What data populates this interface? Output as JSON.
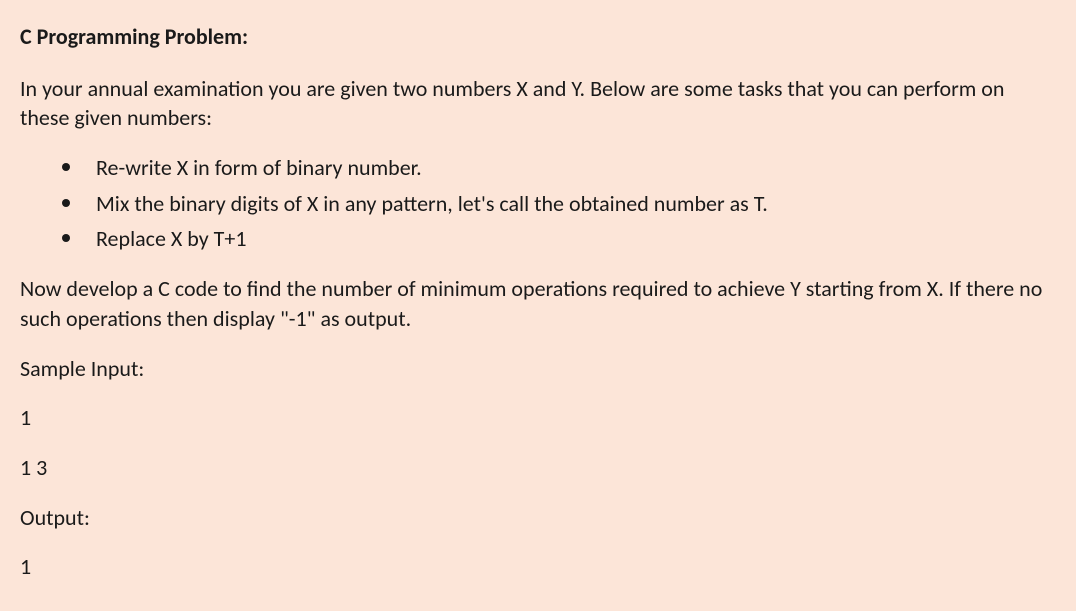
{
  "heading": "C Programming Problem:",
  "intro": "In your annual examination you are given two numbers X and Y. Below are some tasks that you can perform on these given numbers:",
  "bullets": [
    "Re-write X in form of binary number.",
    "Mix the binary digits of X in any pattern, let's call the obtained number as T.",
    "Replace X by T+1"
  ],
  "task": "Now develop a C code to find the number of minimum operations required to achieve Y starting from X. If there no such operations then display \"-1\" as output.",
  "sample_input_label": "Sample Input:",
  "sample_input_line1": "1",
  "sample_input_line2": "1 3",
  "output_label": "Output:",
  "output_line1": "1"
}
